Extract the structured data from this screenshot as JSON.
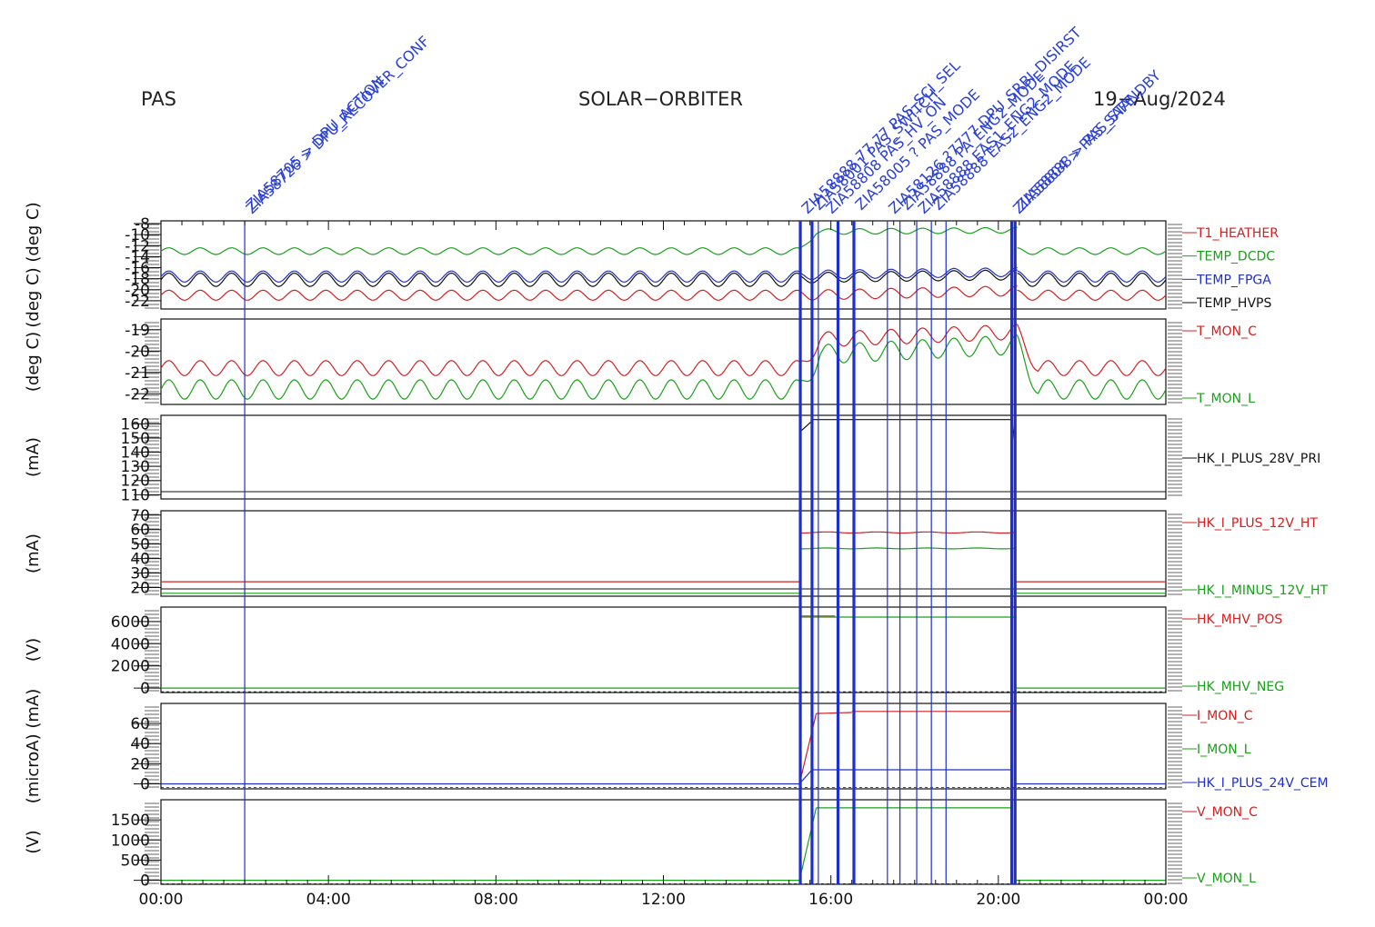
{
  "header": {
    "left": "PAS",
    "center": "SOLAR−ORBITER",
    "date": "19−Aug/2024"
  },
  "colors": {
    "red": "#d42020",
    "green": "#1aa01a",
    "blue": "#2030c8",
    "black": "#111111",
    "marker": "#1e2fd0"
  },
  "chart_data": {
    "type": "line",
    "x_unit": "hours",
    "xlim": [
      0,
      24
    ],
    "x_ticks": [
      {
        "value": 0,
        "label": "00:00"
      },
      {
        "value": 4,
        "label": "04:00"
      },
      {
        "value": 8,
        "label": "08:00"
      },
      {
        "value": 12,
        "label": "12:00"
      },
      {
        "value": 16,
        "label": "16:00"
      },
      {
        "value": 20,
        "label": "20:00"
      },
      {
        "value": 24,
        "label": "00:00"
      }
    ],
    "event_markers": {
      "thick": [
        15.27,
        15.55,
        16.17,
        16.55,
        20.32,
        20.4
      ],
      "thin": [
        2.0,
        15.7,
        17.35,
        17.65,
        18.05,
        18.4,
        18.75
      ]
    },
    "annotations": [
      {
        "x": 2.0,
        "text": "ZIA58726 > DPU_RECOVER_CONF"
      },
      {
        "x": 2.0,
        "text": "ZIA58705 > DPU_ACTION"
      },
      {
        "x": 15.27,
        "text": "ZIA58888 77 77 PAS_SCI_SEL"
      },
      {
        "x": 15.55,
        "text": "ZIA58001 PAS_SWITCH"
      },
      {
        "x": 15.85,
        "text": "ZIA58808 PAS_HV_ON"
      },
      {
        "x": 16.55,
        "text": "ZIA58005 ? PAS_MODE"
      },
      {
        "x": 17.35,
        "text": "ZIA58126 ?7777 DPU_SRBI_DISIRST"
      },
      {
        "x": 17.65,
        "text": "ZIA58888 PA_ENG2_MODE"
      },
      {
        "x": 18.05,
        "text": "ZIA58888 EAS1_ENG2_MODE"
      },
      {
        "x": 18.4,
        "text": "ZIA58888 EAS2_ENG2_MODE"
      },
      {
        "x": 20.32,
        "text": "ZIA58804 > PAS_SAFE"
      },
      {
        "x": 20.4,
        "text": "ZIA58888 > PAS_STANDBY"
      }
    ],
    "panels": [
      {
        "unit": "(deg C) (deg C)",
        "ylim": [
          -23.5,
          -7.5
        ],
        "yticks": [
          -8,
          -10,
          -12,
          -14,
          -16,
          -18,
          -20,
          -22
        ],
        "series": [
          {
            "name": "T1_HEATHER",
            "color": "#d42020",
            "phases": [
              {
                "x0": 0,
                "x1": 15.25,
                "y0": -21.0,
                "y1": -21.0,
                "amp": 0.9,
                "period": 0.75
              },
              {
                "x0": 15.25,
                "x1": 20.45,
                "y0": -21.0,
                "y1": -20.2,
                "amp": 0.9,
                "period": 0.75,
                "ramp": 0.4
              },
              {
                "x0": 20.45,
                "x1": 24,
                "y0": -21.0,
                "y1": -21.0,
                "amp": 0.9,
                "period": 0.75
              }
            ]
          },
          {
            "name": "TEMP_DCDC",
            "color": "#1aa01a",
            "phases": [
              {
                "x0": 0,
                "x1": 15.25,
                "y0": -13.0,
                "y1": -13.0,
                "amp": 0.6,
                "period": 0.75
              },
              {
                "x0": 15.25,
                "x1": 20.45,
                "y0": -9.5,
                "y1": -9.2,
                "amp": 0.5,
                "period": 0.75,
                "ramp": 0.4
              },
              {
                "x0": 20.45,
                "x1": 24,
                "y0": -13.0,
                "y1": -13.0,
                "amp": 0.6,
                "period": 0.75
              }
            ]
          },
          {
            "name": "TEMP_FPGA",
            "color": "#2030c8",
            "phases": [
              {
                "x0": 0,
                "x1": 15.25,
                "y0": -17.6,
                "y1": -17.6,
                "amp": 1.0,
                "period": 0.75
              },
              {
                "x0": 15.25,
                "x1": 20.45,
                "y0": -17.3,
                "y1": -16.8,
                "amp": 0.8,
                "period": 0.75,
                "ramp": 0.4
              },
              {
                "x0": 20.45,
                "x1": 24,
                "y0": -17.6,
                "y1": -17.6,
                "amp": 1.0,
                "period": 0.75
              }
            ]
          },
          {
            "name": "TEMP_HVPS",
            "color": "#111111",
            "phases": [
              {
                "x0": 0,
                "x1": 15.25,
                "y0": -18.2,
                "y1": -18.2,
                "amp": 1.2,
                "period": 0.75
              },
              {
                "x0": 15.25,
                "x1": 20.45,
                "y0": -17.8,
                "y1": -17.3,
                "amp": 0.9,
                "period": 0.75,
                "ramp": 0.4
              },
              {
                "x0": 20.45,
                "x1": 24,
                "y0": -18.2,
                "y1": -18.2,
                "amp": 1.2,
                "period": 0.75
              }
            ]
          }
        ]
      },
      {
        "unit": "(deg C)",
        "ylim": [
          -22.5,
          -18.5
        ],
        "yticks": [
          -19,
          -20,
          -21,
          -22
        ],
        "series": [
          {
            "name": "T_MON_C",
            "color": "#d42020",
            "phases": [
              {
                "x0": 0,
                "x1": 15.25,
                "y0": -20.8,
                "y1": -20.8,
                "amp": 0.35,
                "period": 0.75
              },
              {
                "x0": 15.25,
                "x1": 20.45,
                "y0": -19.5,
                "y1": -19.1,
                "amp": 0.35,
                "period": 0.75,
                "ramp": 0.5
              },
              {
                "x0": 20.45,
                "x1": 24,
                "y0": -20.8,
                "y1": -20.8,
                "amp": 0.35,
                "period": 0.75,
                "ramp": 0.5
              }
            ]
          },
          {
            "name": "T_MON_L",
            "color": "#1aa01a",
            "phases": [
              {
                "x0": 0,
                "x1": 15.25,
                "y0": -21.8,
                "y1": -21.8,
                "amp": 0.45,
                "period": 0.75
              },
              {
                "x0": 15.25,
                "x1": 20.45,
                "y0": -20.2,
                "y1": -19.7,
                "amp": 0.45,
                "period": 0.75,
                "ramp": 0.5
              },
              {
                "x0": 20.45,
                "x1": 24,
                "y0": -21.8,
                "y1": -21.8,
                "amp": 0.45,
                "period": 0.75,
                "ramp": 0.5
              }
            ]
          }
        ]
      },
      {
        "unit": "(mA)",
        "ylim": [
          107,
          166
        ],
        "yticks": [
          160,
          150,
          140,
          130,
          120,
          110
        ],
        "series": [
          {
            "name": "HK_I_PLUS_28V_PRI",
            "color": "#111111",
            "phases": [
              {
                "x0": 15.25,
                "x1": 15.55,
                "y0": 154,
                "y1": 162,
                "amp": 0,
                "period": 1
              },
              {
                "x0": 15.55,
                "x1": 20.3,
                "y0": 163,
                "y1": 163,
                "amp": 0,
                "period": 1
              },
              {
                "x0": 20.3,
                "x1": 20.4,
                "y0": 140,
                "y1": 163,
                "amp": 0,
                "period": 1
              }
            ]
          }
        ]
      },
      {
        "unit": "(mA)",
        "ylim": [
          14,
          73
        ],
        "yticks": [
          70,
          60,
          50,
          40,
          30,
          20
        ],
        "series": [
          {
            "name": "HK_I_PLUS_12V_HT",
            "color": "#d42020",
            "phases": [
              {
                "x0": 0,
                "x1": 15.25,
                "y0": 24,
                "y1": 24,
                "amp": 0,
                "period": 1
              },
              {
                "x0": 15.25,
                "x1": 20.4,
                "y0": 58,
                "y1": 58,
                "amp": 0.4,
                "period": 1.2,
                "ramp": 0.15
              },
              {
                "x0": 20.4,
                "x1": 24,
                "y0": 24,
                "y1": 24,
                "amp": 0,
                "period": 1
              }
            ]
          },
          {
            "name": "HK_I_MINUS_12V_HT",
            "color": "#1aa01a",
            "phases": [
              {
                "x0": 0,
                "x1": 15.25,
                "y0": 16,
                "y1": 16,
                "amp": 0,
                "period": 1
              },
              {
                "x0": 15.25,
                "x1": 20.4,
                "y0": 47,
                "y1": 47,
                "amp": 0.3,
                "period": 1.2,
                "ramp": 0.15
              },
              {
                "x0": 20.4,
                "x1": 24,
                "y0": 16,
                "y1": 16,
                "amp": 0,
                "period": 1
              }
            ]
          }
        ]
      },
      {
        "unit": "(V)",
        "ylim": [
          -400,
          7300
        ],
        "yticks": [
          6000,
          4000,
          2000,
          0
        ],
        "zero_line": true,
        "series": [
          {
            "name": "HK_MHV_POS",
            "color": "#d42020",
            "phases": [
              {
                "x0": 15.25,
                "x1": 16.1,
                "y0": 6500,
                "y1": 6500,
                "amp": 0,
                "period": 1
              }
            ]
          },
          {
            "name": "HK_MHV_NEG",
            "color": "#1aa01a",
            "phases": [
              {
                "x0": 0,
                "x1": 15.25,
                "y0": 0,
                "y1": 0,
                "amp": 0,
                "period": 1
              },
              {
                "x0": 15.25,
                "x1": 20.4,
                "y0": 6400,
                "y1": 6400,
                "amp": 0,
                "period": 1
              },
              {
                "x0": 20.4,
                "x1": 24,
                "y0": 0,
                "y1": 0,
                "amp": 0,
                "period": 1
              }
            ]
          }
        ]
      },
      {
        "unit": "(microA) (mA)",
        "ylim": [
          -5,
          80
        ],
        "yticks": [
          60,
          40,
          20,
          0
        ],
        "zero_line": true,
        "series": [
          {
            "name": "I_MON_C",
            "color": "#d42020",
            "phases": [
              {
                "x0": 15.25,
                "x1": 15.65,
                "y0": 0,
                "y1": 70,
                "amp": 0,
                "period": 1
              },
              {
                "x0": 15.65,
                "x1": 16.5,
                "y0": 70,
                "y1": 71,
                "amp": 0,
                "period": 1
              },
              {
                "x0": 16.5,
                "x1": 20.3,
                "y0": 72,
                "y1": 72,
                "amp": 0,
                "period": 1
              }
            ]
          },
          {
            "name": "I_MON_L",
            "color": "#1aa01a",
            "phases": []
          },
          {
            "name": "HK_I_PLUS_24V_CEM",
            "color": "#2030c8",
            "phases": [
              {
                "x0": 0,
                "x1": 15.25,
                "y0": 0,
                "y1": 0,
                "amp": 0,
                "period": 1
              },
              {
                "x0": 15.25,
                "x1": 15.55,
                "y0": 0,
                "y1": 14,
                "amp": 0,
                "period": 1
              },
              {
                "x0": 15.55,
                "x1": 20.3,
                "y0": 14,
                "y1": 14,
                "amp": 0,
                "period": 1
              },
              {
                "x0": 20.4,
                "x1": 24,
                "y0": 0,
                "y1": 0,
                "amp": 0,
                "period": 1
              }
            ]
          }
        ]
      },
      {
        "unit": "(V)",
        "ylim": [
          -100,
          2000
        ],
        "yticks": [
          1500,
          1000,
          500,
          0
        ],
        "zero_line": true,
        "series": [
          {
            "name": "V_MON_C",
            "color": "#d42020",
            "phases": []
          },
          {
            "name": "V_MON_L",
            "color": "#1aa01a",
            "phases": [
              {
                "x0": 0,
                "x1": 15.25,
                "y0": 0,
                "y1": 0,
                "amp": 0,
                "period": 1
              },
              {
                "x0": 15.25,
                "x1": 15.65,
                "y0": 0,
                "y1": 1800,
                "amp": 0,
                "period": 1
              },
              {
                "x0": 15.65,
                "x1": 20.3,
                "y0": 1800,
                "y1": 1800,
                "amp": 0,
                "period": 1
              },
              {
                "x0": 20.4,
                "x1": 24,
                "y0": 0,
                "y1": 0,
                "amp": 0,
                "period": 1
              }
            ]
          }
        ]
      }
    ]
  }
}
